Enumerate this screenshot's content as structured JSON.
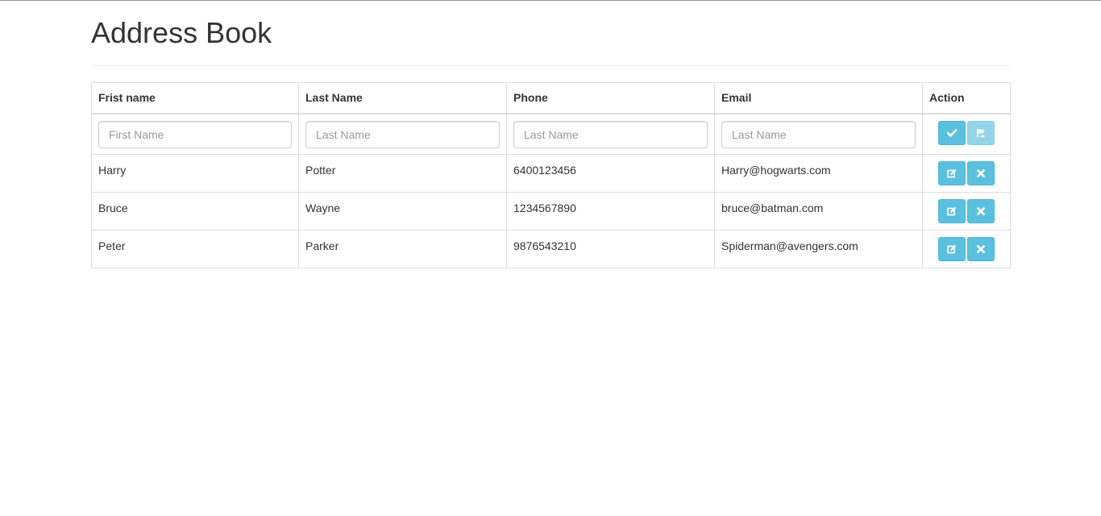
{
  "page": {
    "title": "Address Book"
  },
  "table": {
    "headers": {
      "first_name": "Frist name",
      "last_name": "Last Name",
      "phone": "Phone",
      "email": "Email",
      "action": "Action"
    },
    "new_entry": {
      "first_name_placeholder": "First Name",
      "last_name_placeholder": "Last Name",
      "phone_placeholder": "Last Name",
      "email_placeholder": "Last Name",
      "first_name_value": "",
      "last_name_value": "",
      "phone_value": "",
      "email_value": "",
      "save_icon": "check-icon",
      "reset_icon": "flag-icon",
      "reset_disabled": true
    },
    "rows": [
      {
        "first_name": "Harry",
        "last_name": "Potter",
        "phone": "6400123456",
        "email": "Harry@hogwarts.com"
      },
      {
        "first_name": "Bruce",
        "last_name": "Wayne",
        "phone": "1234567890",
        "email": "bruce@batman.com"
      },
      {
        "first_name": "Peter",
        "last_name": "Parker",
        "phone": "9876543210",
        "email": "Spiderman@avengers.com"
      }
    ],
    "row_actions": {
      "edit_icon": "edit-icon",
      "delete_icon": "remove-icon"
    }
  },
  "colors": {
    "accent": "#5bc0de",
    "accent_border": "#46b8da",
    "text": "#333333",
    "border": "#dddddd"
  }
}
